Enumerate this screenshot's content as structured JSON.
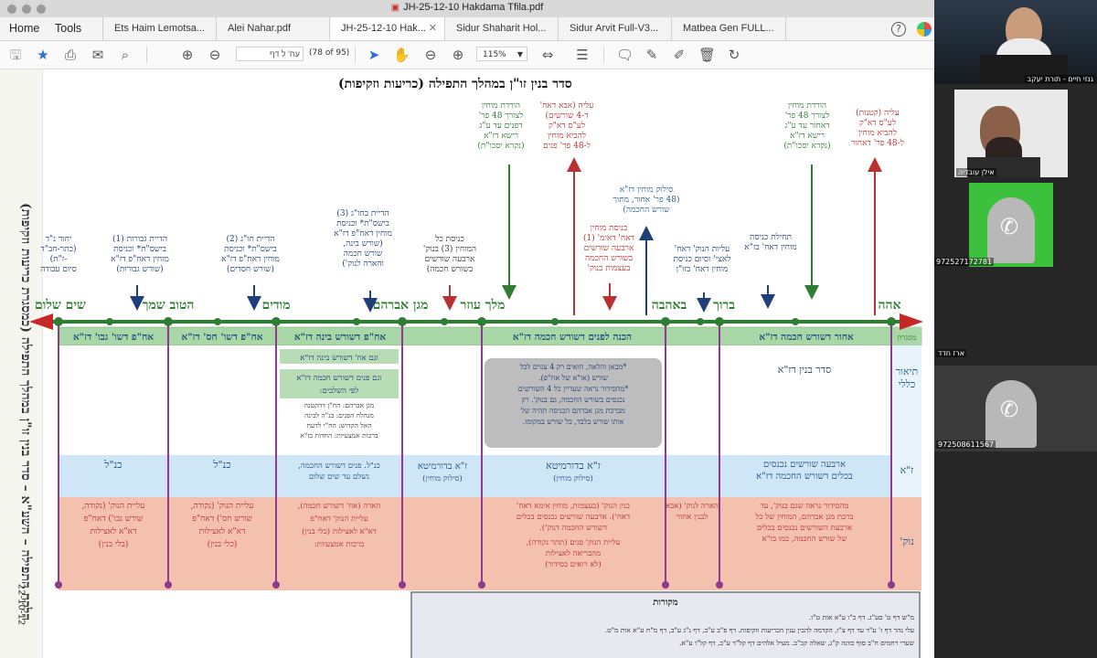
{
  "window": {
    "title": "JH-25-12-10 Hakdama Tfila.pdf"
  },
  "menu": {
    "home": "Home",
    "tools": "Tools"
  },
  "tabs": [
    {
      "label": "Ets Haim Lemotsa..."
    },
    {
      "label": "Alei Nahar.pdf"
    },
    {
      "label": "JH-25-12-10 Hak..."
    },
    {
      "label": "Sidur Shaharit Hol..."
    },
    {
      "label": "Sidur Arvit Full-V3..."
    },
    {
      "label": "Matbea Gen FULL..."
    }
  ],
  "toolbar": {
    "page_value": "עח' ל דף",
    "page_count": "(78 of 95)",
    "zoom": "115%"
  },
  "document": {
    "title": "סדר בנין זו\"ן במהלך התפילה (כריעות וזקיפות)",
    "side_label": "הלקח התפילה – השע\"א – סדר בנין זו\"ן במהלך התפילה (כמסגרת כריעות וזקיפות)",
    "side_date": "22-10-12",
    "stations": [
      "אהה",
      "ברוך",
      "באהבה",
      "מלך עוזר",
      "מגן אברהם",
      "מודים",
      "הטוב שמך",
      "שים שלום"
    ],
    "top_notes": [
      {
        "text": [
          "עליה (קטנות)",
          "לע\"ס דא\"ק",
          "להביא מוחין",
          "ל-48 פר' דאחור"
        ],
        "color": "#b83232"
      },
      {
        "text": [
          "הורדת מוחין",
          "לצורך 48 פר'",
          "דאחור עד ע\"ג",
          "רישא דז\"א",
          "(נקרא יסכו\"ת)"
        ],
        "color": "#2e7d32"
      },
      {
        "text": [
          "סילוק מוחין דז\"א",
          "(48 פר' אחור, מתוך",
          "שורש החכמה)"
        ],
        "color": "#1f5f8b"
      },
      {
        "text": [
          "עליה (אבא דאח'",
          "ד-4 שורשים)",
          "לע\"ס דא\"ק",
          "להביא מוחין",
          "ל-48 פר' פנים"
        ],
        "color": "#b83232"
      },
      {
        "text": [
          "הורדת מוחין",
          "לצורך 48 פר'",
          "דפנים עד ע\"ג",
          "רישא דז\"א",
          "(נקרא יסכו\"ת)"
        ],
        "color": "#2e7d32"
      }
    ],
    "mid_notes": [
      {
        "text": [
          "תחילת כניסת",
          "מוחין דאח' בז\"א"
        ],
        "color": "#1f3f7a"
      },
      {
        "text": [
          "עליות הנוק' דאח'",
          "לאצי' וסיום כניסת",
          "מוחין דאח' בזו\"ן"
        ],
        "color": "#1f3f7a"
      },
      {
        "text": [
          "כניסת מוחין",
          "דאח' דאימ' (1)",
          "ארבעה שורשים",
          "בשורש החכמה",
          "בעצמות בנוק'"
        ],
        "color": "#b83232"
      },
      {
        "text": [
          "כניסת כל",
          "המוחין (3) בנוק'",
          "ארבעה שורשים",
          "בשורש חכמה)"
        ],
        "color": "#333333"
      },
      {
        "text": [
          "הדיית בחו\"ג (3)",
          "בישס\"ת* וכניסת",
          "מוחין דאח\"פ דז\"א",
          "(שורש בינה,",
          "שורש חכמה",
          "והארה לנוק')"
        ],
        "color": "#1f3f7a"
      },
      {
        "text": [
          "הדיית חו\"ג (2)",
          "בישס\"ת* וכניסת",
          "מוחין דאח\"פ דז\"א",
          "(שורש חסדים)"
        ],
        "color": "#1f3f7a"
      },
      {
        "text": [
          "הדיית גבורות (1)",
          "בישס\"ת* וכניסת",
          "מוחין דאח\"פ דז\"א",
          "(שורש גבורות)"
        ],
        "color": "#1f3f7a"
      },
      {
        "text": [
          "יחוד נ\"ד",
          "(כתר-חב\"ד",
          "-ז\"ת)",
          "סיום עבודה"
        ],
        "color": "#1f3f7a"
      }
    ],
    "row_labels": [
      "מסגרת",
      "תיאור כללי",
      "ז\"א",
      "נוק'"
    ],
    "frame_row": [
      "אחור דשורש חכמה דז\"א",
      "הכנה לפנים דשורש חכמה דז\"א",
      "אח\"פ דשורש בינה דז\"א",
      "אח\"פ דשו' חס' דז\"א",
      "אח\"פ דשו' גבו' דז\"א"
    ],
    "general_row": {
      "main": "סדר בנין דז\"א",
      "grey_box": [
        "*מבאן והלאה, חואים רק 4 צגוים לכל",
        "שורש (או\"א של אח\"פ).",
        "*מהסידור נראה שעדיין כל 4 השורשים",
        "נכנסים בשורש החכמה, גם בנוק'. רק",
        "מברכת מגן אברהם הכניסה תהיה של",
        "אותו שורש בלבד, כל שורש במקומו."
      ],
      "green_boxes": [
        "וגם אח' דשורש בינה דז\"א",
        "וגם פנים דשורש חכמה דז\"א",
        "לפי השלבים:"
      ],
      "column_text": [
        "מגן אברהם: הח\"ן דהקטנה",
        "מנהלה הפנים: בנ\"ה לבינה",
        "האל הקדוש: הח\"י לדעת",
        "ברכות אמצעיות: החדות בז\"א"
      ]
    },
    "za_row": [
      "ארבעה שורשים נכנסים",
      "בכלים דשורש החכמה דז\"א",
      "ז\"א בדורמיטא",
      "(סילוק מוחין)",
      "כנ\"ל. פנים דשורש החכמה,",
      "נשלם עד שים שלום",
      "כנ\"ל",
      "כנ\"ל"
    ],
    "nuk_row": [
      "מהסידור נראה שגם בנוק', עד",
      "ברכת מגן אברהם, המוחין של כל",
      "ארבעת השורשים נכנסים בכלים",
      "של שורש החכמה, כמו בז\"א",
      "הארה לנוק' (אבא",
      "לבנין אחור",
      "בנין הנוק' (בעצמות, מוחין אימא דאח'",
      "דאח'). ארבעה שורשים נכנסים בכלים",
      "דשורש החכמה דנוק').",
      "עליית הנוק' פנים (תתר נקודה),",
      "מהבריאה לאצילות",
      "(לא רואים בסידור)",
      "הארה (אח' דשורש חכמה),",
      "עליית הנוק' דאח\"פ",
      "דא\"א לאצילות (כלי בנין)",
      "ברכות אמצעיות:",
      "עליית הנוק' (נקודה,",
      "שורש חס') דאח\"פ",
      "דא\"א לאצילות",
      "(כלי בנין)",
      "עליית הנוק' (נקודה,",
      "שורש גבו') דאח\"פ",
      "דא\"א לאצילות",
      "(בלי בנין)"
    ],
    "sources": {
      "title": "מקורות",
      "lines": [
        "מ\"ש דף ט' סע\"ג. דף כ\"ו ע\"א אות ט\"ו.",
        "עלי נהר דף ז' ע\"ד עד דף צ\"ו, הקדמה להבין ענין הכריעות וזקיפות. דף פ\"ב ע\"ב, דף נ\"ג ע\"ב, דף מ\"ח ע\"א אות מ\"ט.",
        "שערי רחמים ח\"ב סוף כוונה ק\"ג, שאלה קכ\"ב. מעיל אלהים דף קל\"ד ע\"ב, דף קל\"ו ע\"א."
      ]
    }
  },
  "participants": [
    {
      "name": "גנזי חיים - תורת יעקב"
    },
    {
      "name": "אילן עובדיה"
    },
    {
      "name": "972527172781"
    },
    {
      "name": "ארז חדד"
    },
    {
      "name": "972508611567"
    }
  ]
}
